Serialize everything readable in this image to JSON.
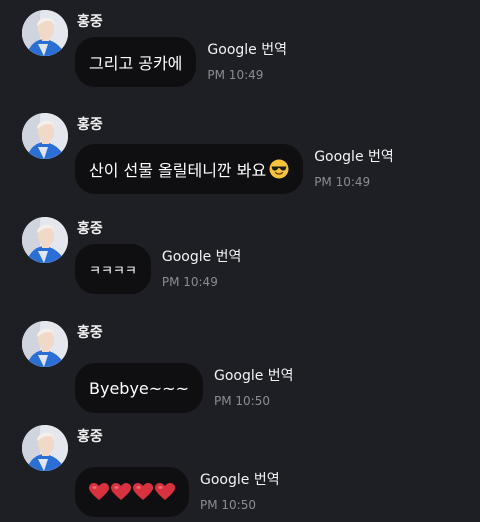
{
  "messages": [
    {
      "sender": "홍중",
      "text": "그리고 공카에",
      "translate_label": "Google 번역",
      "time": "PM 10:49"
    },
    {
      "sender": "홍중",
      "text": "산이 선물 올릴테니깐 봐요",
      "emoji": "smiling-face-with-sunglasses-icon",
      "translate_label": "Google 번역",
      "time": "PM 10:49"
    },
    {
      "sender": "홍중",
      "text": "ㅋㅋㅋㅋ",
      "translate_label": "Google 번역",
      "time": "PM 10:49"
    },
    {
      "sender": "홍중",
      "text": "Byebye~~~",
      "translate_label": "Google 번역",
      "time": "PM 10:50"
    },
    {
      "sender": "홍중",
      "hearts": 4,
      "translate_label": "Google 번역",
      "time": "PM 10:50"
    }
  ],
  "colors": {
    "background": "#1e1f24",
    "bubble": "#0f0f12",
    "timestamp": "#8a8c94",
    "heart": "#d8323f",
    "avatar_jacket": "#2a6fd6"
  }
}
